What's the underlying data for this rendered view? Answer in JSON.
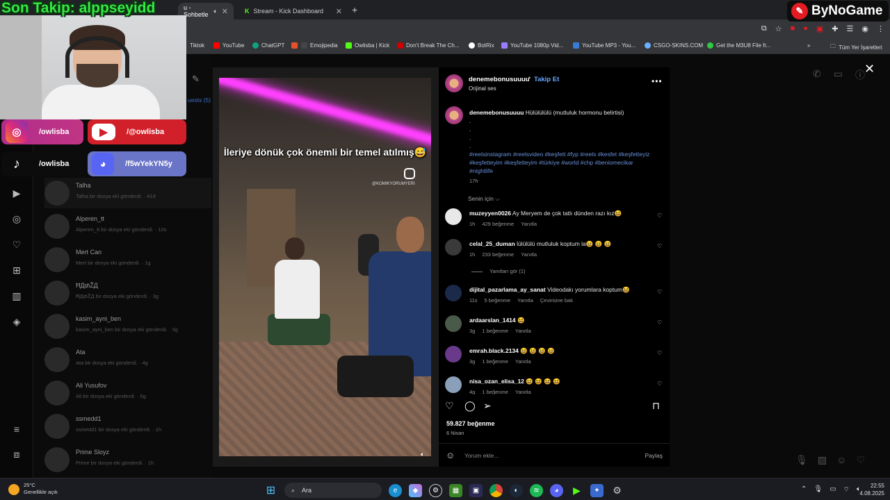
{
  "browser": {
    "tabs": [
      {
        "label": "u - Sohbetle",
        "active": true
      },
      {
        "label": "Stream - Kick Dashboard",
        "active": false
      }
    ],
    "bookmarks": [
      {
        "label": "Tiktok",
        "color": "#222"
      },
      {
        "label": "YouTube",
        "color": "#ff0000"
      },
      {
        "label": "ChatGPT",
        "color": "#10a37f"
      },
      {
        "label": "",
        "color": "#e8502a"
      },
      {
        "label": "Emojipedia",
        "color": "#444"
      },
      {
        "label": "Owlisba | Kick",
        "color": "#53fc18"
      },
      {
        "label": "Don't Break The Ch...",
        "color": "#c00"
      },
      {
        "label": "BotRix",
        "color": "#fff"
      },
      {
        "label": "YouTube 1080p Vid...",
        "color": "#9a7cff"
      },
      {
        "label": "YouTube MP3 - You...",
        "color": "#3a7bd5"
      },
      {
        "label": "CSGO-SKINS.COM",
        "color": "#6ab0ff"
      },
      {
        "label": "Get the M3U8 File fr...",
        "color": "#2ecc40"
      }
    ],
    "all_bookmarks": "Tüm Yer İşaretleri"
  },
  "stream_overlay": {
    "title": "Son Takip: alppseyidd",
    "socials": [
      {
        "platform": "instagram",
        "handle": "/owlisba"
      },
      {
        "platform": "youtube",
        "handle": "/@owlisba"
      },
      {
        "platform": "tiktok",
        "handle": "/owlisba"
      },
      {
        "platform": "discord",
        "handle": "/f5wYekYN5y"
      }
    ],
    "brand": "ByNoGame"
  },
  "messages_app": {
    "requests_tab": "uests (5)",
    "conversations": [
      {
        "name": "Talha",
        "preview": "Talha bir dosya eki gönderdi. · 41d"
      },
      {
        "name": "Alperen_tt",
        "preview": "Alperen_tt bir dosya eki gönderdi. · 10s"
      },
      {
        "name": "Mert Can",
        "preview": "Mert bir dosya eki gönderdi. · 1g"
      },
      {
        "name": "ĦД₥ŽД",
        "preview": "ĦД₥ŽД bir dosya eki gönderdi. · 3g"
      },
      {
        "name": "kasim_ayni_ben",
        "preview": "kasim_ayni_ben bir dosya eki gönderdi. · 3g"
      },
      {
        "name": "Ata",
        "preview": "Ata bir dosya eki gönderdi. · 4g"
      },
      {
        "name": "Ali Yusufov",
        "preview": "Ali bir dosya eki gönderdi. · 6g"
      },
      {
        "name": "ssmedd1",
        "preview": "ssmedd1 bir dosya eki gönderdi. · 1h"
      },
      {
        "name": "Prime Sloyz",
        "preview": "Prime bir dosya eki gönderdi. · 1h"
      }
    ]
  },
  "reel": {
    "video_caption": "İleriye dönük çok önemli bir temel atılmış😅",
    "watermark": "@KOMIKYORUMYERI",
    "header": {
      "username": "denemebonusuuuu",
      "follow": "Takip Et",
      "audio": "Orijinal ses"
    },
    "caption": {
      "username": "denemebonusuuuu",
      "text": "Hülülülülü (mutluluk hormonu belirtisi)",
      "dots": ".\n.\n.\n.",
      "hashtags": "#reelsinstagram #reelsvideo #keşfett #fyp #reels #kesfet #keşfetteyiz #keşfetteyim #keşfetteyim #türkiye #world #chp #beniomecikar #nightlife",
      "age": "17h"
    },
    "for_you": "Senin için ⌵",
    "comments": [
      {
        "user": "muzeyyen0026",
        "text": "Ay Meryem de çok tatlı dünden razı kız😆",
        "age": "1h",
        "likes": "429 beğenme",
        "reply": "Yanıtla",
        "translate": "",
        "avatar_color": "#e8e8e8"
      },
      {
        "user": "celal_25_duman",
        "text": "lülülülü mutluluk koptum la😆 😆 😆",
        "age": "1h",
        "likes": "233 beğenme",
        "reply": "Yanıtla",
        "translate": "",
        "avatar_color": "#3a3a3a"
      },
      {
        "user": "dijital_pazarlama_ay_sanat",
        "text": "Videodakı yorumlara koptum😆",
        "age": "11s",
        "likes": "5 beğenme",
        "reply": "Yanıtla",
        "translate": "Çevirisine bak",
        "avatar_color": "#1c2a4a"
      },
      {
        "user": "ardaarslan_1414",
        "text": "😆",
        "age": "3g",
        "likes": "1 beğenme",
        "reply": "Yanıtla",
        "translate": "",
        "avatar_color": "#4a5a4a"
      },
      {
        "user": "emrah.black.2134",
        "text": "😆 😆 😆 😆",
        "age": "3g",
        "likes": "1 beğenme",
        "reply": "Yanıtla",
        "translate": "",
        "avatar_color": "#6a3a8a"
      },
      {
        "user": "nisa_ozan_elisa_12",
        "text": "😆 😆 😆 😆",
        "age": "4g",
        "likes": "1 beğenme",
        "reply": "Yanıtla",
        "translate": "",
        "avatar_color": "#8aa0b8"
      }
    ],
    "view_replies": "Yanıtları gör (1)",
    "likes_count": "59.827 beğenme",
    "date": "6 Nisan",
    "comment_placeholder": "Yorum ekle...",
    "share": "Paylaş"
  },
  "taskbar": {
    "weather_temp": "25°C",
    "weather_desc": "Genellikle açık",
    "search_label": "Ara",
    "time": "22:55",
    "date": "4.08.2025"
  }
}
